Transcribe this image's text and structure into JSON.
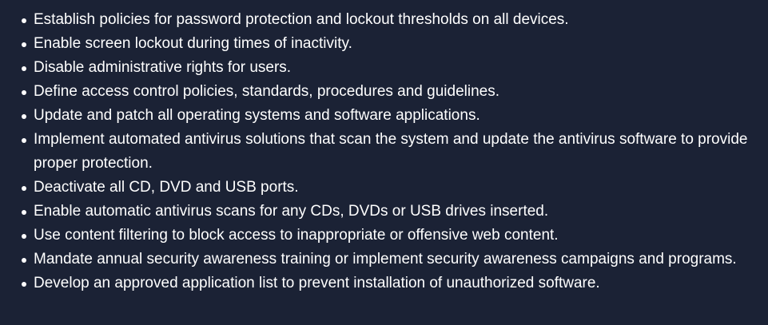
{
  "list": {
    "items": [
      {
        "text": "Establish policies for password protection and lockout thresholds on all devices."
      },
      {
        "text": "Enable screen lockout during times of inactivity."
      },
      {
        "text": "Disable administrative rights for users."
      },
      {
        "text": "Define access control policies, standards, procedures and guidelines."
      },
      {
        "text": "Update and patch all operating systems and software applications."
      },
      {
        "text": "Implement automated antivirus solutions that scan the system and update the antivirus software to provide proper protection."
      },
      {
        "text": "Deactivate all CD, DVD and USB ports."
      },
      {
        "text": "Enable automatic antivirus scans for any CDs, DVDs or USB drives inserted."
      },
      {
        "text": "Use content filtering to block access to inappropriate or offensive web content."
      },
      {
        "text": "Mandate annual security awareness training or implement security awareness campaigns and programs."
      },
      {
        "text": "Develop an approved application list to prevent installation of unauthorized software."
      }
    ]
  },
  "colors": {
    "background": "#1b2235",
    "text": "#ffffff"
  }
}
